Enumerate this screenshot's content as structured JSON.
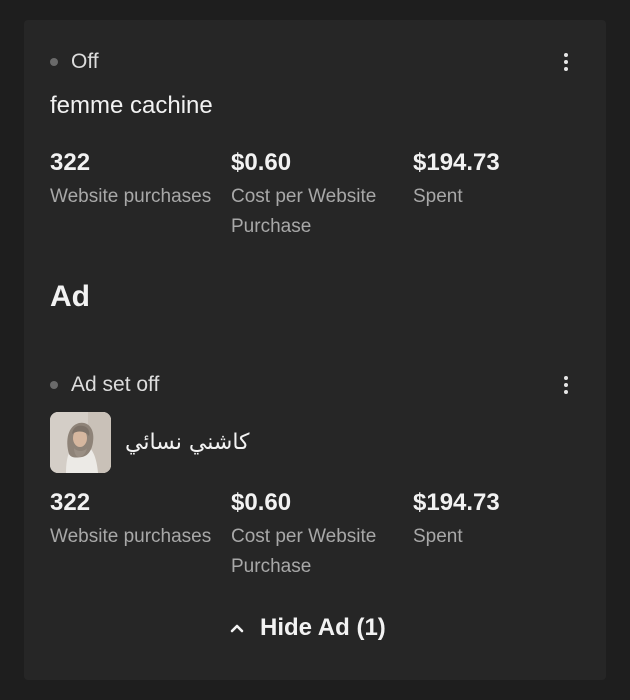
{
  "campaign": {
    "status": "Off",
    "name": "femme cachine",
    "metrics": [
      {
        "value": "322",
        "label": "Website purchases"
      },
      {
        "value": "$0.60",
        "label": "Cost per Website Purchase"
      },
      {
        "value": "$194.73",
        "label": "Spent"
      }
    ]
  },
  "section": {
    "heading": "Ad"
  },
  "ad": {
    "status": "Ad set off",
    "name": "كاشني نسائي",
    "thumbnail_icon": "ad-thumbnail-image",
    "metrics": [
      {
        "value": "322",
        "label": "Website purchases"
      },
      {
        "value": "$0.60",
        "label": "Cost per Website Purchase"
      },
      {
        "value": "$194.73",
        "label": "Spent"
      }
    ]
  },
  "toggle": {
    "label": "Hide Ad (1)",
    "icon": "chevron-up-icon"
  },
  "colors": {
    "background": "#1e1e1e",
    "card": "#262626",
    "primary_text": "#f2f2f2",
    "secondary_text": "#a8a8a8",
    "status_dot": "#6a6a6a"
  }
}
